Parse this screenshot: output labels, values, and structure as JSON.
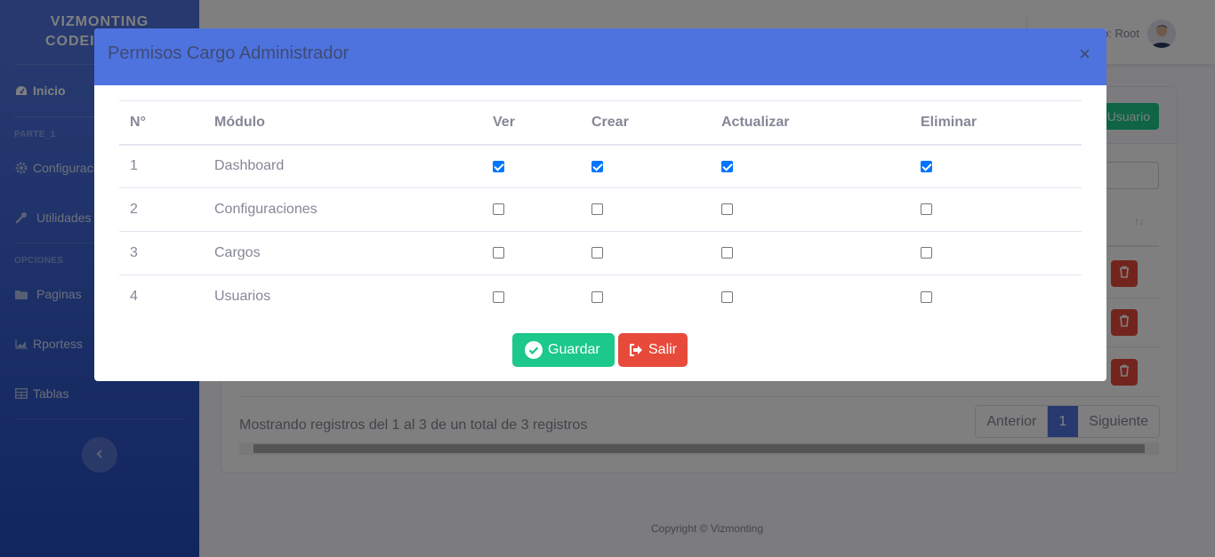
{
  "brand": {
    "line1": "VIZMONTING",
    "line2": "CODEIGNITER"
  },
  "sidebar": {
    "home": "Inicio",
    "section1": "PARTE_1",
    "config": "Configuraciones",
    "utils": "Utilidades",
    "section2": "OPCIONES",
    "pages": "Paginas",
    "reports": "Rportess",
    "tables": "Tablas"
  },
  "topbar": {
    "user": "Usuario: Root"
  },
  "card": {
    "add_button": "Nuevo Usuario",
    "info": "Mostrando registros del 1 al 3 de un total de 3 registros",
    "pager": {
      "prev": "Anterior",
      "current": "1",
      "next": "Siguiente"
    }
  },
  "footer": "Copyright © Vizmonting",
  "modal": {
    "title": "Permisos Cargo Administrador",
    "close": "×",
    "headers": [
      "N°",
      "Módulo",
      "Ver",
      "Crear",
      "Actualizar",
      "Eliminar"
    ],
    "rows": [
      {
        "n": "1",
        "module": "Dashboard",
        "ver": true,
        "crear": true,
        "actualizar": true,
        "eliminar": true
      },
      {
        "n": "2",
        "module": "Configuraciones",
        "ver": false,
        "crear": false,
        "actualizar": false,
        "eliminar": false
      },
      {
        "n": "3",
        "module": "Cargos",
        "ver": false,
        "crear": false,
        "actualizar": false,
        "eliminar": false
      },
      {
        "n": "4",
        "module": "Usuarios",
        "ver": false,
        "crear": false,
        "actualizar": false,
        "eliminar": false
      }
    ],
    "save_label": "Guardar",
    "exit_label": "Salir"
  },
  "colors": {
    "primary": "#4e73df",
    "success": "#1cc88a",
    "danger": "#e74a3b"
  },
  "icons": [
    "tachometer-icon",
    "gear-icon",
    "wrench-icon",
    "folder-icon",
    "chart-area-icon",
    "table-icon",
    "chevron-left-icon",
    "check-circle-icon",
    "sign-out-icon",
    "trash-icon",
    "sort-icon"
  ]
}
